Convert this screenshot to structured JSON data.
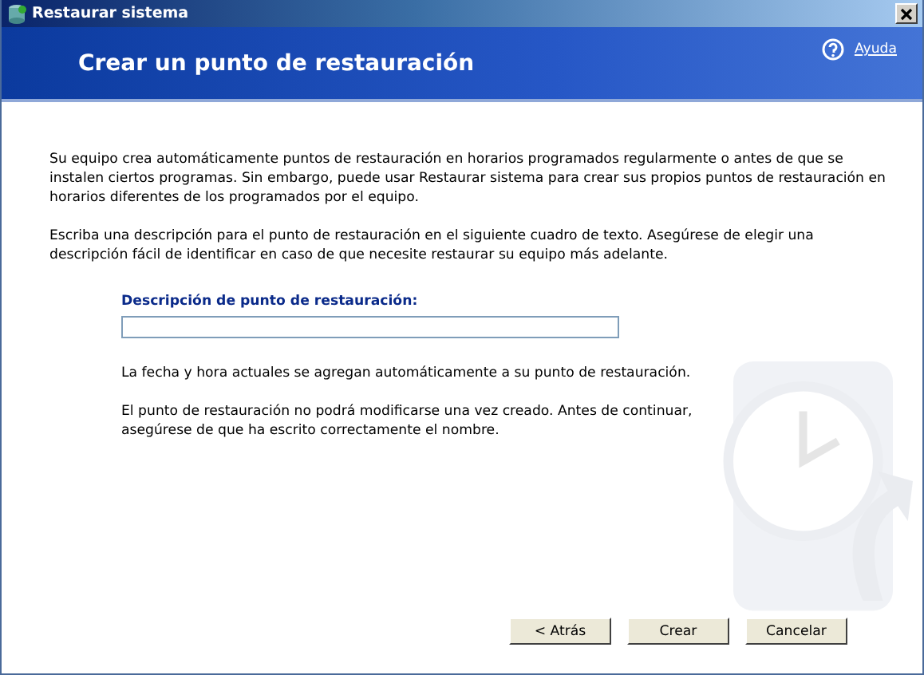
{
  "window": {
    "title": "Restaurar sistema"
  },
  "header": {
    "title": "Crear un punto de restauración",
    "help_link": "Ayuda"
  },
  "paragraphs": [
    "Su equipo crea automáticamente puntos de restauración en horarios programados regularmente o antes de que se instalen ciertos programas. Sin embargo, puede usar Restaurar sistema para crear sus propios puntos de restauración en horarios diferentes de los programados por el equipo.",
    "Escriba una descripción para el punto de restauración en el siguiente cuadro de texto. Asegúrese de elegir una descripción fácil de identificar en caso de que necesite restaurar su equipo más adelante."
  ],
  "field": {
    "label": "Descripción de punto de restauración:"
  },
  "notes": [
    "La fecha y hora actuales se agregan automáticamente a su punto de restauración.",
    "El punto de restauración no podrá modificarse una vez creado. Antes de continuar, asegúrese de que ha escrito correctamente el nombre."
  ],
  "buttons": [
    "< Atrás",
    "Crear",
    "Cancelar"
  ]
}
